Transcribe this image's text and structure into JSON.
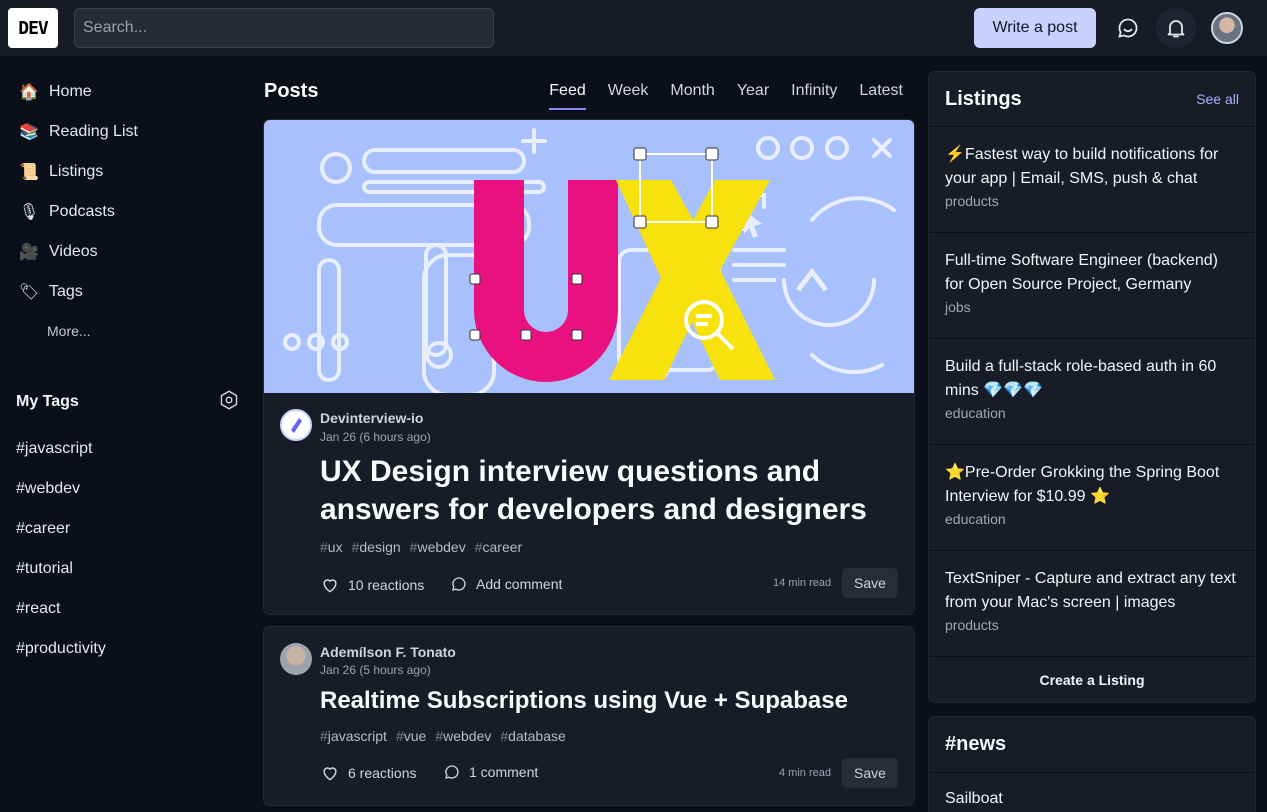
{
  "header": {
    "logo": "DEV",
    "search_placeholder": "Search...",
    "write_post_label": "Write a post",
    "icons": [
      "chat-icon",
      "bell-icon",
      "avatar"
    ]
  },
  "nav": {
    "items": [
      {
        "icon": "house-icon",
        "label": "Home"
      },
      {
        "icon": "reading-list-icon",
        "label": "Reading List"
      },
      {
        "icon": "listings-icon",
        "label": "Listings"
      },
      {
        "icon": "microphone-icon",
        "label": "Podcasts"
      },
      {
        "icon": "video-icon",
        "label": "Videos"
      },
      {
        "icon": "tag-icon",
        "label": "Tags"
      }
    ],
    "more_label": "More..."
  },
  "my_tags": {
    "title": "My Tags",
    "tags": [
      "#javascript",
      "#webdev",
      "#career",
      "#tutorial",
      "#react",
      "#productivity"
    ]
  },
  "feed": {
    "title": "Posts",
    "tabs": [
      "Feed",
      "Week",
      "Month",
      "Year",
      "Infinity",
      "Latest"
    ],
    "active_tab": "Feed",
    "posts": [
      {
        "author": "Devinterview-io",
        "date": "Jan 26 (6 hours ago)",
        "title": "UX Design interview questions and answers for developers and designers",
        "tags": [
          "ux",
          "design",
          "webdev",
          "career"
        ],
        "reactions": "10 reactions",
        "comments": "Add comment",
        "read_time": "14 min read",
        "save_label": "Save",
        "cover_text": "UX"
      },
      {
        "author": "Ademílson F. Tonato",
        "date": "Jan 26 (5 hours ago)",
        "title": "Realtime Subscriptions using Vue + Supabase",
        "tags": [
          "javascript",
          "vue",
          "webdev",
          "database"
        ],
        "reactions": "6 reactions",
        "comments": "1 comment",
        "read_time": "4 min read",
        "save_label": "Save"
      }
    ]
  },
  "listings": {
    "title": "Listings",
    "see_all": "See all",
    "items": [
      {
        "title": "⚡Fastest way to build notifications for your app | Email, SMS, push & chat",
        "category": "products"
      },
      {
        "title": "Full-time Software Engineer (backend) for Open Source Project, Germany",
        "category": "jobs"
      },
      {
        "title": "Build a full-stack role-based auth in 60 mins 💎💎💎",
        "category": "education"
      },
      {
        "title": "⭐Pre-Order Grokking the Spring Boot Interview for $10.99 ⭐",
        "category": "education"
      },
      {
        "title": "TextSniper - Capture and extract any text from your Mac's screen | images",
        "category": "products"
      }
    ],
    "create_label": "Create a Listing"
  },
  "news": {
    "title": "#news",
    "items": [
      "Sailboat"
    ]
  },
  "colors": {
    "background": "#0b0f19",
    "header": "#161b26",
    "card": "#171c27",
    "accent": "#818cf8",
    "write_button": "#c7d2fe",
    "cover_bg": "#a8c0fb",
    "cover_pink": "#e8117f",
    "cover_yellow": "#f7e20d"
  }
}
